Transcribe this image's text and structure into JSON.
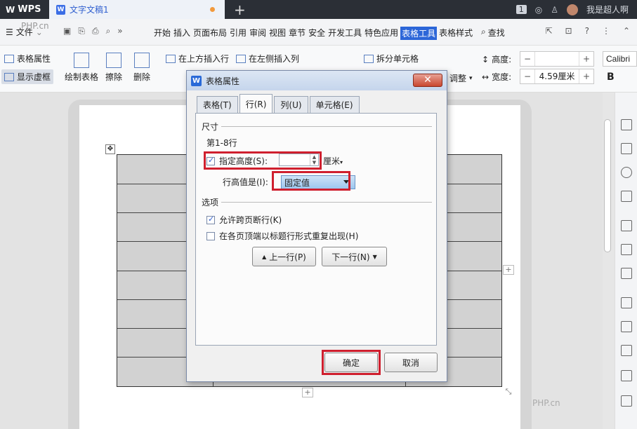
{
  "titlebar": {
    "app_label": "WPS",
    "doc_tab": "文字文稿1",
    "tab_count": "1",
    "user": "我是超人啊"
  },
  "menubar": {
    "file": "文件",
    "tabs": [
      "开始",
      "插入",
      "页面布局",
      "引用",
      "审阅",
      "视图",
      "章节",
      "安全",
      "开发工具",
      "特色应用",
      "表格工具",
      "表格样式"
    ],
    "active_tab": "表格工具",
    "search": "查找"
  },
  "ribbon": {
    "table_props": "表格属性",
    "show_gridlines": "显示虚框",
    "draw_table": "绘制表格",
    "erase": "擦除",
    "delete": "删除",
    "insert_above": "在上方插入行",
    "insert_left": "在左侧插入列",
    "split_cell": "拆分单元格",
    "adjust": "调整",
    "height_label": "高度:",
    "height_value": "",
    "width_label": "宽度:",
    "width_value": "4.59厘米",
    "font": "Calibri",
    "bold": "B"
  },
  "dialog": {
    "title": "表格属性",
    "close": "✕",
    "tabs": [
      "表格(T)",
      "行(R)",
      "列(U)",
      "单元格(E)"
    ],
    "active_tab": "行(R)",
    "section_size": "尺寸",
    "row_range": "第1-8行",
    "specify_height": "指定高度(S):",
    "specify_height_checked": true,
    "height_value": "",
    "unit": "厘米",
    "row_height_is": "行高值是(I):",
    "row_height_mode": "固定值",
    "section_options": "选项",
    "allow_break": "允许跨页断行(K)",
    "allow_break_checked": true,
    "repeat_header": "在各页顶端以标题行形式重复出现(H)",
    "repeat_header_checked": false,
    "prev_row": "上一行(P)",
    "next_row": "下一行(N)",
    "ok": "确定",
    "cancel": "取消"
  },
  "watermark": "PHP.cn",
  "colors": {
    "annotation_red": "#cf1f2e",
    "active_tab_blue": "#2c66d8"
  }
}
